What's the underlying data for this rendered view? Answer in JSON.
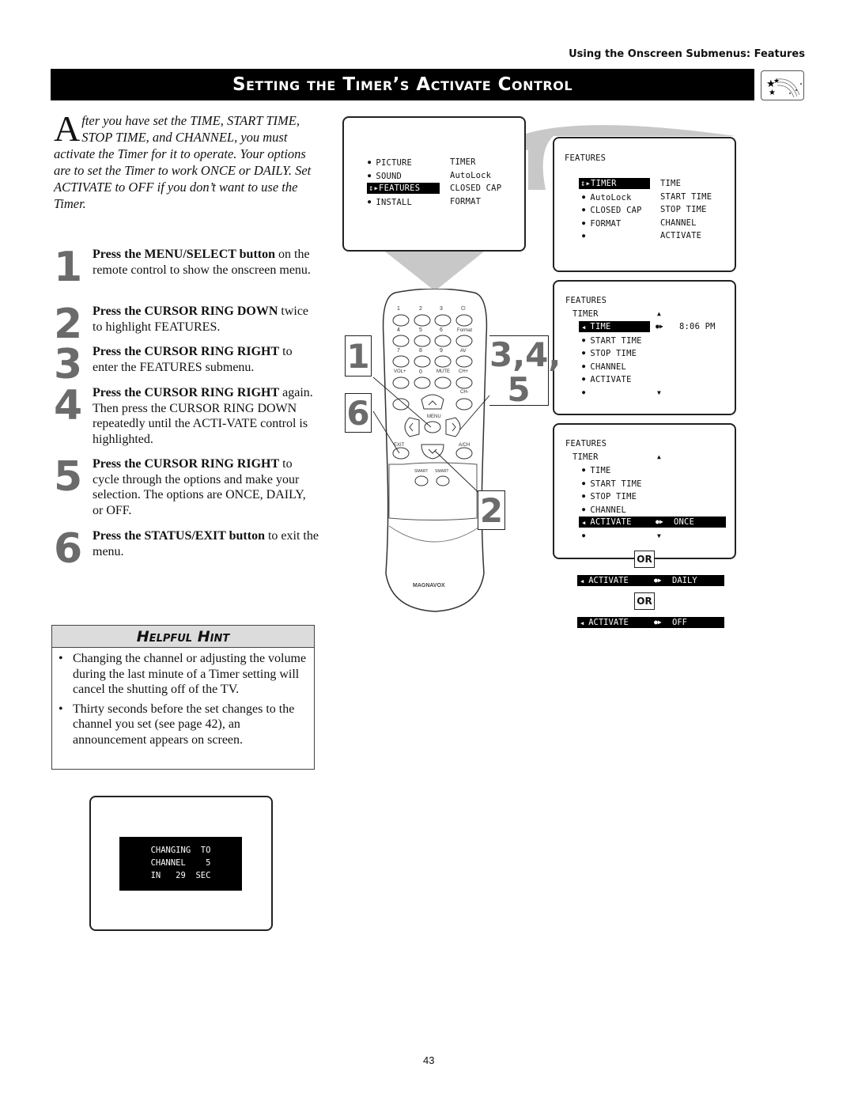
{
  "section_header": "Using the Onscreen Submenus: Features",
  "title": "Setting the Timer’s Activate Control",
  "title_icon": "shooting-stars-icon",
  "intro": {
    "drop_cap": "A",
    "text": "fter you have set the TIME, START TIME, STOP TIME, and CHANNEL, you must activate the Timer for it to operate. Your options are to set the Timer to work ONCE or DAILY. Set ACTIVATE to OFF if you don’t want to use the Timer."
  },
  "steps": [
    {
      "num": "1",
      "bold": "Press the MENU/SELECT button",
      "text": " on the remote control to show the onscreen menu."
    },
    {
      "num": "2",
      "bold": "Press the CURSOR RING DOWN",
      "text": " twice to highlight FEATURES."
    },
    {
      "num": "3",
      "bold": "Press the CURSOR RING RIGHT",
      "text": " to enter the FEATURES submenu."
    },
    {
      "num": "4",
      "bold": "Press the CURSOR RING RIGHT",
      "text": " again. Then press the CURSOR RING DOWN repeatedly until the ACTI-VATE control is highlighted."
    },
    {
      "num": "5",
      "bold": "Press the CURSOR RING RIGHT",
      "text": " to cycle through the options and make your selection. The options are ONCE, DAILY, or OFF."
    },
    {
      "num": "6",
      "bold": "Press the STATUS/EXIT button",
      "text": " to exit the menu."
    }
  ],
  "hint": {
    "title": "Helpful Hint",
    "items": [
      "Changing the channel or adjusting the volume during the last minute of a Timer setting will cancel the shutting off of the TV.",
      "Thirty seconds before the set changes to the channel you set (see page 42), an announcement appears on screen."
    ]
  },
  "screen_main_menu": {
    "left": [
      "PICTURE",
      "SOUND",
      "FEATURES",
      "INSTALL"
    ],
    "right": [
      "TIMER",
      "AutoLock",
      "CLOSED CAP",
      "FORMAT"
    ],
    "highlighted": "FEATURES"
  },
  "screen_features": {
    "heading": "FEATURES",
    "left": [
      "TIMER",
      "AutoLock",
      "CLOSED CAP",
      "FORMAT",
      ""
    ],
    "right": [
      "TIME",
      "START TIME",
      "STOP TIME",
      "CHANNEL",
      "ACTIVATE"
    ],
    "highlighted": "TIMER"
  },
  "screen_timer": {
    "heading": "FEATURES",
    "sub": "TIMER",
    "items": [
      "TIME",
      "START TIME",
      "STOP TIME",
      "CHANNEL",
      "ACTIVATE",
      ""
    ],
    "highlighted": "TIME",
    "value": "8:06 PM"
  },
  "screen_activate": {
    "heading": "FEATURES",
    "sub": "TIMER",
    "items": [
      "TIME",
      "START TIME",
      "STOP TIME",
      "CHANNEL",
      "ACTIVATE",
      ""
    ],
    "highlighted": "ACTIVATE",
    "value": "ONCE"
  },
  "or_label": "OR",
  "activate_options": [
    {
      "label": "ACTIVATE",
      "value": "DAILY"
    },
    {
      "label": "ACTIVATE",
      "value": "OFF"
    }
  ],
  "remote": {
    "brand": "MAGNAVOX",
    "keys": [
      "1",
      "2",
      "3",
      "⏻",
      "4",
      "5",
      "6",
      "Format",
      "7",
      "8",
      "9",
      "AV",
      "VOL+",
      "0",
      "MUTE",
      "CH+"
    ],
    "labels": {
      "ch_minus": "CH-",
      "menu": "MENU",
      "exit": "EXIT",
      "ach": "A/CH",
      "smart1": "SMART",
      "smart2": "SMART"
    }
  },
  "callouts": {
    "c1": "1",
    "c6": "6",
    "c345_line1": "3,4,",
    "c345_line2": "5",
    "c2": "2"
  },
  "announcement": [
    "CHANGING  TO",
    "CHANNEL    5",
    "IN   29  SEC"
  ],
  "page_number": "43"
}
